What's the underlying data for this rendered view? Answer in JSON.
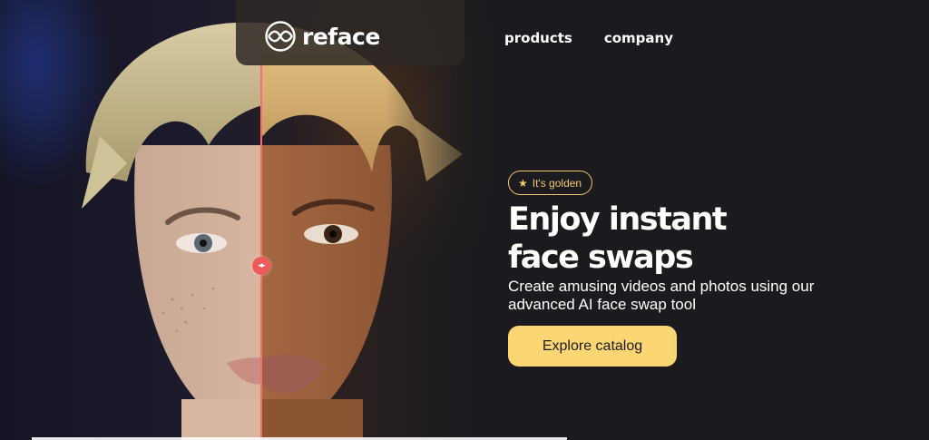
{
  "header": {
    "logo_text": "reface",
    "nav": [
      {
        "label": "products"
      },
      {
        "label": "company"
      }
    ]
  },
  "hero": {
    "badge": {
      "icon": "star-icon",
      "label": "It's golden"
    },
    "headline_line1": "Enjoy instant",
    "headline_line2": "face swaps",
    "subtitle": "Create amusing videos and photos using our advanced AI face swap tool",
    "cta_label": "Explore catalog",
    "compare_handle_icon": "drag-arrows-icon"
  },
  "colors": {
    "background": "#1b1b1f",
    "accent_yellow": "#fcd673",
    "badge_gold": "#f5c96b",
    "compare_red": "#ff6b6b"
  }
}
